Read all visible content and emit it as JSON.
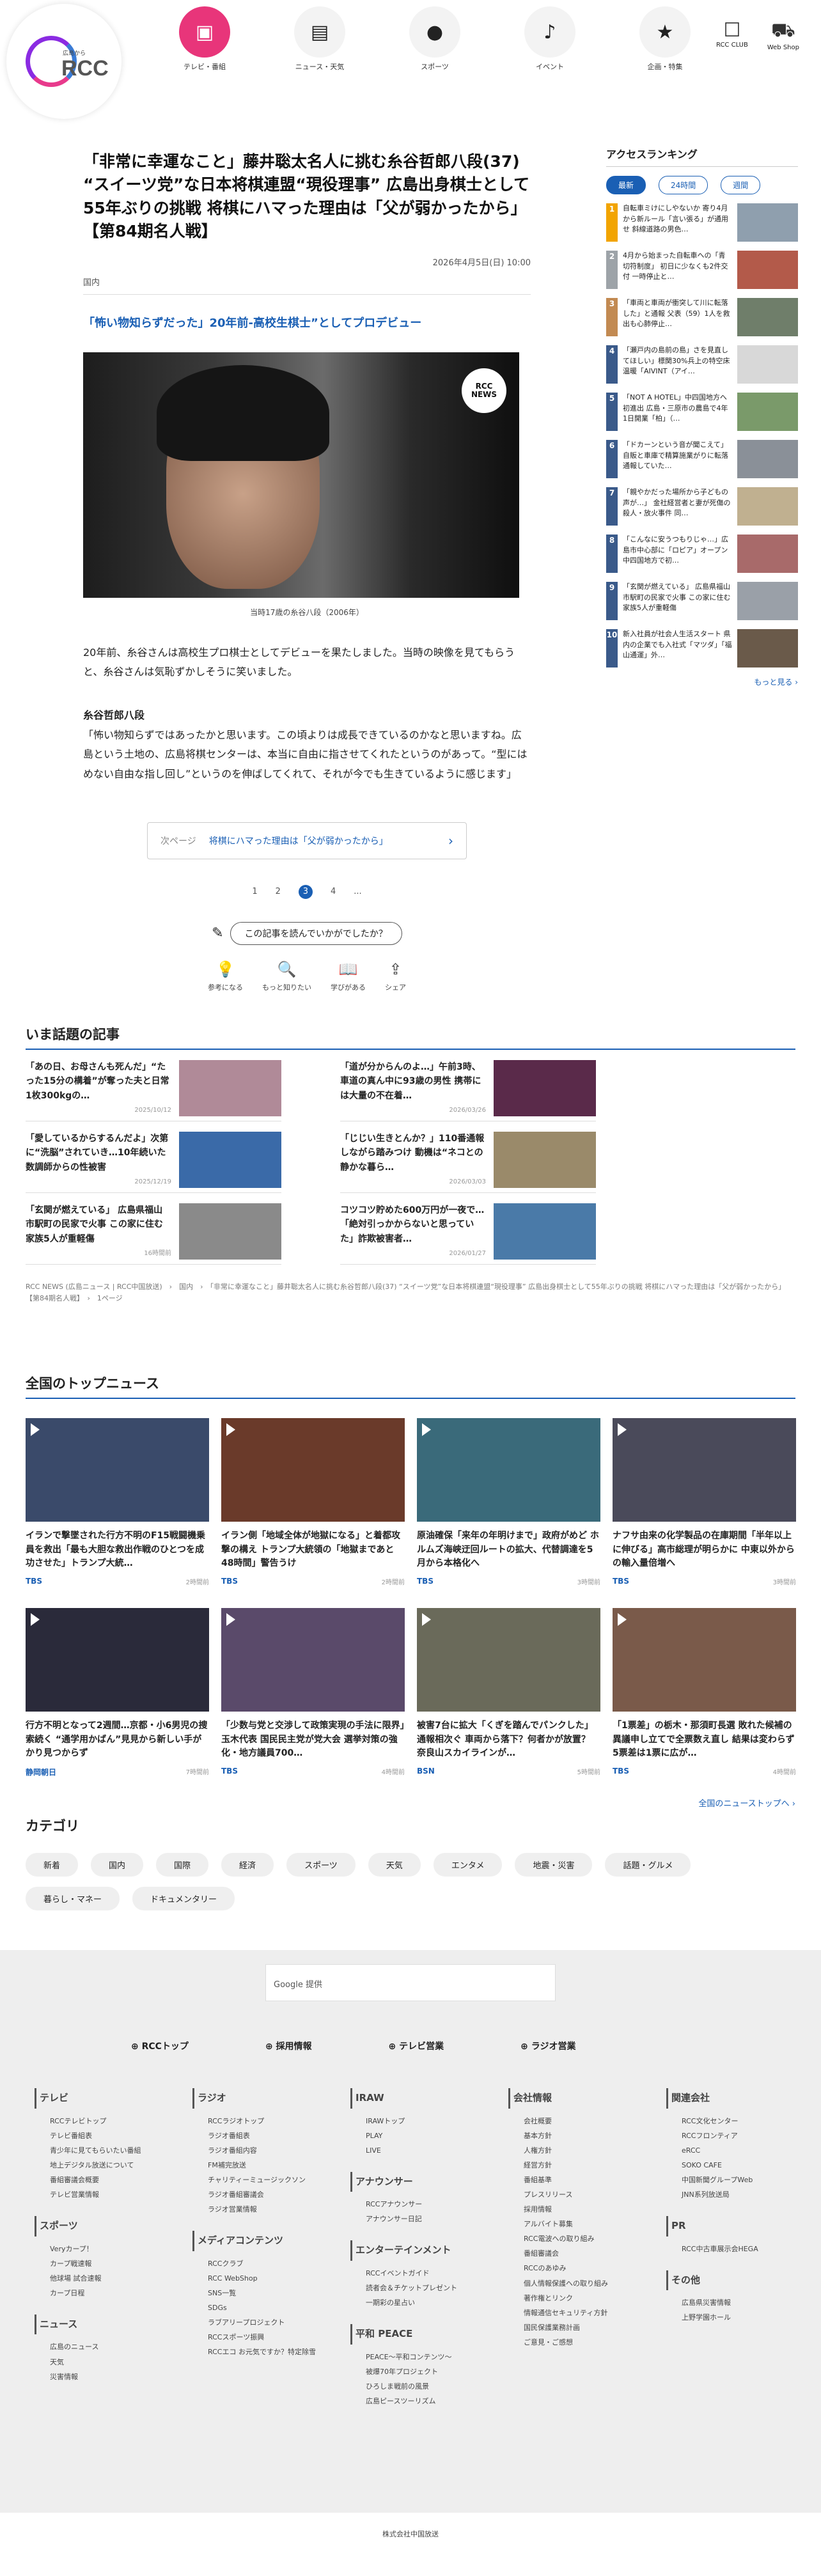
{
  "header": {
    "logo_small": "広島から",
    "logo": "RCC",
    "nav": [
      {
        "label": "テレビ・番組",
        "icon": "tv-icon",
        "glyph": "▣"
      },
      {
        "label": "ニュース・天気",
        "icon": "news-icon",
        "glyph": "▤"
      },
      {
        "label": "スポーツ",
        "icon": "carp-icon",
        "glyph": "●"
      },
      {
        "label": "イベント",
        "icon": "music-note-icon",
        "glyph": "♪"
      },
      {
        "label": "企画・特集",
        "icon": "star-icon",
        "glyph": "★"
      }
    ],
    "right": [
      {
        "label": "RCC CLUB",
        "glyph": "☐"
      },
      {
        "label": "Web Shop",
        "glyph": "⛟"
      }
    ]
  },
  "article": {
    "title": "「非常に幸運なこと」藤井聡太名人に挑む糸谷哲郎八段(37) “スイーツ党”な日本将棋連盟“現役理事” 広島出身棋士として55年ぶりの挑戦 将棋にハマった理由は「父が弱かったから」【第84期名人戦】",
    "date": "2026年4月5日(日) 10:00",
    "category": "国内",
    "subheading": "「怖い物知らずだった」20年前-高校生棋士”としてプロデビュー",
    "news_badge": "RCC NEWS",
    "caption": "当時17歳の糸谷八段（2006年）",
    "para1": "20年前、糸谷さんは高校生プロ棋士としてデビューを果たしました。当時の映像を見てもらうと、糸谷さんは気恥ずかしそうに笑いました。",
    "speaker": "糸谷哲郎八段",
    "quote": "「怖い物知らずではあったかと思います。この頃よりは成長できているのかなと思いますね。広島という土地の、広島将棋センターは、本当に自由に指させてくれたというのがあって。“型にはめない自由な指し回し”というのを伸ばしてくれて、それが今でも生きているように感じます」",
    "next_label": "次ページ",
    "next_title": "将棋にハマった理由は「父が弱かったから」",
    "next_arrow": "›",
    "pages": [
      "1",
      "2",
      "3",
      "4",
      "..."
    ],
    "ask": "この記事を読んでいかがでしたか？",
    "reactions": [
      {
        "label": "参考になる",
        "glyph": "💡"
      },
      {
        "label": "もっと知りたい",
        "glyph": "🔍"
      },
      {
        "label": "学びがある",
        "glyph": "📖"
      },
      {
        "label": "シェア",
        "glyph": "⇪"
      }
    ]
  },
  "ranking": {
    "title": "アクセスランキング",
    "tabs": [
      "最新",
      "24時間",
      "週間"
    ],
    "items": [
      {
        "num": "1",
        "text": "自転車ミけにしやないか 寄り4月から新ルール「言い張る」が通用せ 斜線道路の男色…",
        "color": "#f2a400",
        "thumb": "#8f9fae"
      },
      {
        "num": "2",
        "text": "4月から始まった自転車への「青切符制度」 初日に少なくも2件交付 一時停止と…",
        "color": "#9da3a8",
        "thumb": "#b35a4a"
      },
      {
        "num": "3",
        "text": "「車両と車両が衝突して川に転落した」と通報 父表（59）1人を救出も心肺停止…",
        "color": "#c28a52",
        "thumb": "#6f7e6a"
      },
      {
        "num": "4",
        "text": "「瀬戸内の島前の島」さを見直してほしい」標関30%兵上の特空床温暖「AIVINT（アイ…",
        "color": "#3a5a8a",
        "thumb": "#d8d8d8"
      },
      {
        "num": "5",
        "text": "「NOT A HOTEL」中四国地方へ初進出 広島・三原市の農島で4年1日開業「柏」（…",
        "color": "#3a5a8a",
        "thumb": "#7a9a6a"
      },
      {
        "num": "6",
        "text": "「ドカーンという音が聞こえて」自販と車庫で精算施業がりに転落 通報していた…",
        "color": "#3a5a8a",
        "thumb": "#8a9098"
      },
      {
        "num": "7",
        "text": "「親やかだった場所から子どもの声が…」 金社経営者と妻が死傷の殺人・放火事件 同…",
        "color": "#3a5a8a",
        "thumb": "#c0b090"
      },
      {
        "num": "8",
        "text": "「こんなに安うつもりじゃ…」広島市中心部に「ロピア」オープン 中四国地方で初…",
        "color": "#3a5a8a",
        "thumb": "#a86a6a"
      },
      {
        "num": "9",
        "text": "「玄関が燃えている」 広島県福山市駅町の民家で火事 この家に住む家族5人が重軽傷",
        "color": "#3a5a8a",
        "thumb": "#9aa0a8"
      },
      {
        "num": "10",
        "text": "新入社員が社会人生活スタート 県内の企業でも入社式「マツダ」「福山通運」外…",
        "color": "#3a5a8a",
        "thumb": "#6a5a4a"
      }
    ],
    "more": "もっと見る ›"
  },
  "topics": {
    "title": "いま話題の記事",
    "items": [
      {
        "text": "「あの日、お母さんも死んだ」“たった15分の構着”が奪った夫と日常 1枚300kgの…",
        "date": "2025/10/12",
        "color": "#b08a98"
      },
      {
        "text": "「道が分からんのよ…」午前3時、車道の真ん中に93歳の男性 携帯には大量の不在着…",
        "date": "2026/03/26",
        "color": "#5a2a4a"
      },
      {
        "text": "「愛しているからするんだよ」次第に“洗脳”されていき…10年続いた数調師からの性被害",
        "date": "2025/12/19",
        "color": "#3a6aa8"
      },
      {
        "text": "「じじい生きとんか？」110番通報しながら踏みつけ 動機は“ネコとの静かな暮ら…",
        "date": "2026/03/03",
        "color": "#9a8a6a"
      },
      {
        "text": "「玄関が燃えている」 広島県福山市駅町の民家で火事 この家に住む家族5人が重軽傷",
        "date": "16時間前",
        "color": "#8a8a8a"
      },
      {
        "text": "コツコツ貯めた600万円が一夜で…「絶対引っかからないと思っていた」詐欺被害者…",
        "date": "2026/01/27",
        "color": "#4a7aa8"
      }
    ],
    "crumb": "RCC NEWS (広島ニュース | RCC中国放送)　›　国内　›　「非常に幸運なこと」藤井聡太名人に挑む糸谷哲郎八段(37) “スイーツ党”な日本将棋連盟“現役理事” 広島出身棋士として55年ぶりの挑戦 将棋にハマった理由は「父が弱かったから」【第84期名人戦】　›　1ページ"
  },
  "national": {
    "title": "全国のトップニュース",
    "items": [
      {
        "text": "イランで撃墜された行方不明のF15戦闘機乗員を救出「最も大胆な救出作戦のひとつを成功させた」トランプ大統…",
        "src": "TBS",
        "time": "2時間前",
        "color": "#3a4a6a"
      },
      {
        "text": "イラン側「地域全体が地獄になる」と着都攻撃の構え トランプ大統領の「地獄まであと48時間」警告うけ",
        "src": "TBS",
        "time": "2時間前",
        "color": "#6a3a2a"
      },
      {
        "text": "原油確保「来年の年明けまで」政府がめど ホルムズ海峡迂回ルートの拡大、代替調達を5月から本格化へ",
        "src": "TBS",
        "time": "3時間前",
        "color": "#3a6a7a"
      },
      {
        "text": "ナフサ由来の化学製品の在庫期間「半年以上に伸びる」高市総理が明らかに 中東以外からの輸入量倍増へ",
        "src": "TBS",
        "time": "3時間前",
        "color": "#4a4a5a"
      },
      {
        "text": "行方不明となって2週間…京都・小6男児の捜索続く “通学用かばん”見見から新しい手がかり見つからず",
        "src": "静岡朝日",
        "time": "7時間前",
        "color": "#2a2a3a"
      },
      {
        "text": "「少数与党と交渉して政策実現の手法に限界」玉木代表 国民民主党が党大会 選挙対策の強化・地方議員700…",
        "src": "TBS",
        "time": "4時間前",
        "color": "#5a4a6a"
      },
      {
        "text": "被害7台に拡大「くぎを踏んでパンクした」通報相次ぐ 車両から落下？何者かが放置？ 奈良山スカイラインが…",
        "src": "BSN",
        "time": "5時間前",
        "color": "#6a6a5a"
      },
      {
        "text": "「1票差」の栃木・那須町長選 敗れた候補の異議申し立てで全票数え直し 結果は変わらず5票差は1票に広が…",
        "src": "TBS",
        "time": "4時間前",
        "color": "#7a5a4a"
      }
    ],
    "more": "全国のニューストップへ ›"
  },
  "categories": {
    "title": "カテゴリ",
    "items": [
      "新着",
      "国内",
      "国際",
      "経済",
      "スポーツ",
      "天気",
      "エンタメ",
      "地震・災害",
      "話題・グルメ",
      "暮らし・マネー",
      "ドキュメンタリー"
    ]
  },
  "footer": {
    "search": "Google 提供",
    "links": [
      "RCCトップ",
      "採用情報",
      "テレビ営業",
      "ラジオ営業"
    ],
    "cols": [
      [
        {
          "h": "テレビ",
          "items": [
            "RCCテレビトップ",
            "テレビ番組表",
            "青少年に見てもらいたい番組",
            "地上デジタル放送について",
            "番組審議会概要",
            "テレビ営業情報"
          ]
        },
        {
          "h": "スポーツ",
          "items": [
            "Veryカープ！",
            "カープ戦速報",
            "他球場 試合速報",
            "カープ日程"
          ]
        },
        {
          "h": "ニュース",
          "items": [
            "広島のニュース",
            "天気",
            "災害情報"
          ]
        }
      ],
      [
        {
          "h": "ラジオ",
          "items": [
            "RCCラジオトップ",
            "ラジオ番組表",
            "ラジオ番組内容",
            "FM補完放送",
            "チャリティーミュージックソン",
            "ラジオ番組審議会",
            "ラジオ営業情報"
          ]
        },
        {
          "h": "メディアコンテンツ",
          "items": [
            "RCCクラブ",
            "RCC WebShop",
            "SNS一覧",
            "SDGs",
            "ラブアリープロジェクト",
            "RCCスポーツ振興",
            "RCCエコ お元気ですか？特定除雪"
          ]
        }
      ],
      [
        {
          "h": "IRAW",
          "items": [
            "IRAWトップ",
            "PLAY",
            "LIVE"
          ]
        },
        {
          "h": "アナウンサー",
          "items": [
            "RCCアナウンサー",
            "アナウンサー日記"
          ]
        },
        {
          "h": "エンターテインメント",
          "items": [
            "RCCイベントガイド",
            "読者会＆チケットプレゼント",
            "一期彩の星占い"
          ]
        },
        {
          "h": "平和 PEACE",
          "items": [
            "PEACE～平和コンテンツ～",
            "被爆70年プロジェクト",
            "ひろしま戦前の風景",
            "広島ピースツーリズム"
          ]
        }
      ],
      [
        {
          "h": "会社情報",
          "items": [
            "会社概要",
            "基本方針",
            "人権方針",
            "経営方針",
            "番組基準",
            "プレスリリース",
            "採用情報",
            "アルバイト募集",
            "RCC電波への取り組み",
            "番組審議会",
            "RCCのあゆみ",
            "個人情報保護への取り組み",
            "著作権とリンク",
            "情報通信セキュリティ方針",
            "国民保護業務計画",
            "ご意見・ご感想"
          ]
        }
      ],
      [
        {
          "h": "関連会社",
          "items": [
            "RCC文化センター",
            "RCCフロンティア",
            "eRCC",
            "SOKO CAFE",
            "中国新聞グループWeb",
            "JNN系列放送局"
          ]
        },
        {
          "h": "PR",
          "items": [
            "RCC中古車展示会HEGA"
          ]
        },
        {
          "h": "その他",
          "items": [
            "広島県災害情報",
            "上野学園ホール"
          ]
        }
      ]
    ],
    "copyright": "株式会社中国放送"
  }
}
